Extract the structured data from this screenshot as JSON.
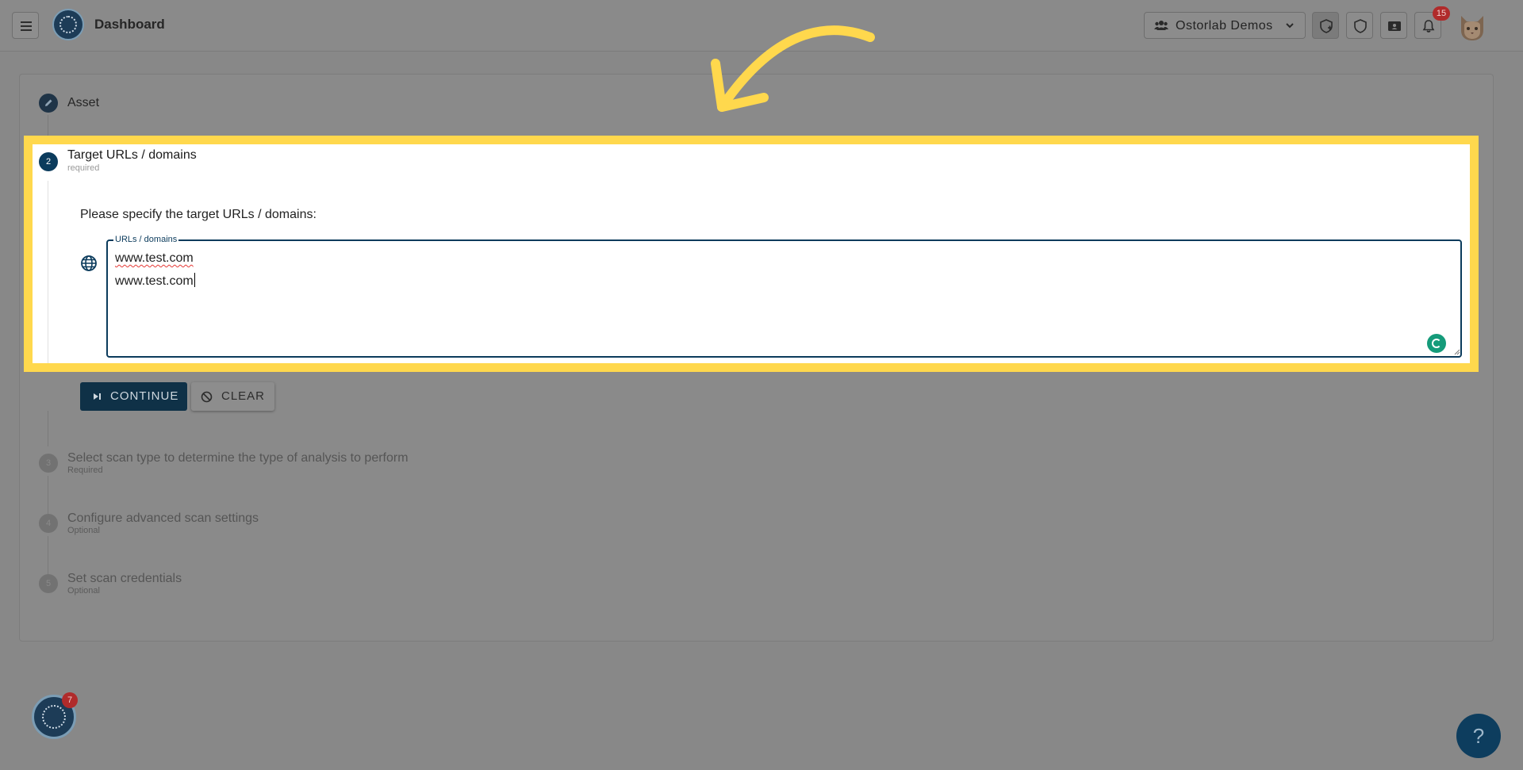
{
  "header": {
    "title": "Dashboard",
    "organization": "Ostorlab Demos",
    "notification_count": "15"
  },
  "stepper": {
    "steps": [
      {
        "number": "",
        "title": "Asset",
        "subtitle": ""
      },
      {
        "number": "2",
        "title": "Target URLs / domains",
        "subtitle": "required"
      },
      {
        "number": "3",
        "title": "Select scan type to determine the type of analysis to perform",
        "subtitle": "Required"
      },
      {
        "number": "4",
        "title": "Configure advanced scan settings",
        "subtitle": "Optional"
      },
      {
        "number": "5",
        "title": "Set scan credentials",
        "subtitle": "Optional"
      }
    ]
  },
  "targets": {
    "prompt": "Please specify the target URLs / domains:",
    "field_label": "URLs / domains",
    "lines": [
      "www.test.com",
      "www.test.com"
    ]
  },
  "actions": {
    "continue_label": "CONTINUE",
    "clear_label": "CLEAR"
  },
  "floating": {
    "assistant_badge": "7",
    "help_label": "?"
  },
  "colors": {
    "highlight": "#ffd84d",
    "primary": "#0b3b5c",
    "badge": "#b02b2b"
  }
}
